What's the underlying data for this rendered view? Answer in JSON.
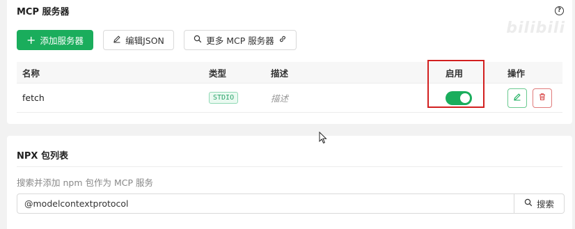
{
  "mcp": {
    "title": "MCP 服务器",
    "add_button": "添加服务器",
    "edit_json_button": "编辑JSON",
    "more_button": "更多 MCP 服务器",
    "columns": {
      "name": "名称",
      "type": "类型",
      "desc": "描述",
      "enable": "启用",
      "ops": "操作"
    },
    "rows": [
      {
        "name": "fetch",
        "type": "STDIO",
        "desc": "描述",
        "enabled": true
      }
    ],
    "watermark": "bilibili"
  },
  "npx": {
    "title": "NPX 包列表",
    "hint": "搜索并添加 npm 包作为 MCP 服务",
    "search_value": "@modelcontextprotocol",
    "search_button": "搜索"
  },
  "icons": {
    "help": "help-circle-icon",
    "plus": "plus-icon",
    "edit": "pencil-icon",
    "search": "search-icon",
    "link": "link-icon",
    "delete": "trash-icon"
  },
  "colors": {
    "accent": "#1aad5c",
    "danger": "#d21f1f",
    "highlight_box": "#d21f1f"
  }
}
